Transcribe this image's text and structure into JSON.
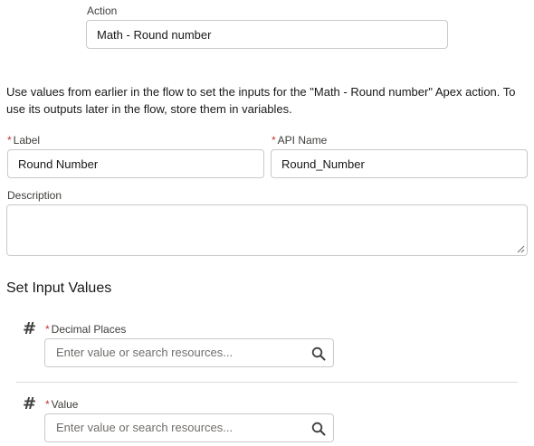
{
  "action": {
    "label": "Action",
    "value": "Math - Round number"
  },
  "intro_text": "Use values from earlier in the flow to set the inputs for the \"Math - Round number\" Apex action. To use its outputs later in the flow, store them in variables.",
  "label_field": {
    "required_mark": "*",
    "label": "Label",
    "value": "Round Number"
  },
  "api_name_field": {
    "required_mark": "*",
    "label": "API Name",
    "value": "Round_Number"
  },
  "description_field": {
    "label": "Description",
    "value": ""
  },
  "inputs_section": {
    "title": "Set Input Values",
    "items": [
      {
        "type_icon": "#",
        "required_mark": "*",
        "label": "Decimal Places",
        "placeholder": "Enter value or search resources..."
      },
      {
        "type_icon": "#",
        "required_mark": "*",
        "label": "Value",
        "placeholder": "Enter value or search resources..."
      }
    ]
  },
  "colors": {
    "required": "#c23934",
    "border": "#c9c9c9",
    "placeholder": "#706e6b"
  }
}
